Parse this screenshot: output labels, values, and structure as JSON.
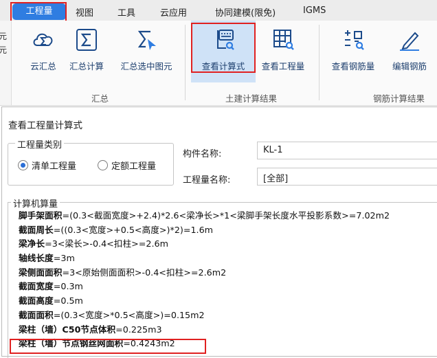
{
  "menu": {
    "active": "工程量",
    "items": [
      "视图",
      "工具",
      "云应用",
      "协同建模(限免)",
      "IGMS"
    ]
  },
  "left_stub": [
    "元",
    "元"
  ],
  "ribbon": {
    "buttons": [
      {
        "label": "云汇总",
        "icon": "cloud-sigma-icon"
      },
      {
        "label": "汇总计算",
        "icon": "sigma-icon"
      },
      {
        "label": "汇总选中图元",
        "icon": "sigma-cursor-icon"
      },
      {
        "label": "查看计算式",
        "icon": "view-formula-icon"
      },
      {
        "label": "查看工程量",
        "icon": "view-quantity-icon"
      },
      {
        "label": "查看钢筋量",
        "icon": "view-rebar-icon"
      },
      {
        "label": "编辑钢筋",
        "icon": "edit-rebar-icon"
      }
    ],
    "groups": [
      "汇总",
      "土建计算结果",
      "钢筋计算结果"
    ]
  },
  "dialog": {
    "title": "查看工程量计算式",
    "category": {
      "legend": "工程量类别",
      "options": [
        "清单工程量",
        "定额工程量"
      ],
      "selected": "清单工程量"
    },
    "component_label": "构件名称:",
    "component_value": "KL-1",
    "quantity_label": "工程量名称:",
    "quantity_value": "[全部]",
    "calc_legend": "计算机算量",
    "calc_lines": [
      {
        "name": "脚手架面积",
        "formula": "=(0.3<截面宽度>+2.4)*2.6<梁净长>*1<梁脚手架长度水平投影系数>=7.02m2"
      },
      {
        "name": "截面周长",
        "formula": "=((0.3<宽度>+0.5<高度>)*2)=1.6m"
      },
      {
        "name": "梁净长",
        "formula": "=3<梁长>-0.4<扣柱>=2.6m"
      },
      {
        "name": "轴线长度",
        "formula": "=3m"
      },
      {
        "name": "梁侧面面积",
        "formula": "=3<原始侧面面积>-0.4<扣柱>=2.6m2"
      },
      {
        "name": "截面宽度",
        "formula": "=0.3m"
      },
      {
        "name": "截面高度",
        "formula": "=0.5m"
      },
      {
        "name": "截面面积",
        "formula": "=(0.3<宽度>*0.5<高度>)=0.15m2"
      },
      {
        "name": "梁柱（墙）C50节点体积",
        "formula": "=0.225m3"
      },
      {
        "name": "梁柱（墙）节点钢丝网面积",
        "formula": "=0.4243m2"
      }
    ]
  },
  "colors": {
    "accent": "#2f7de1",
    "highlight": "#e02020",
    "selected_tool": "#cfe2f7",
    "icon": "#1b4a8a"
  }
}
